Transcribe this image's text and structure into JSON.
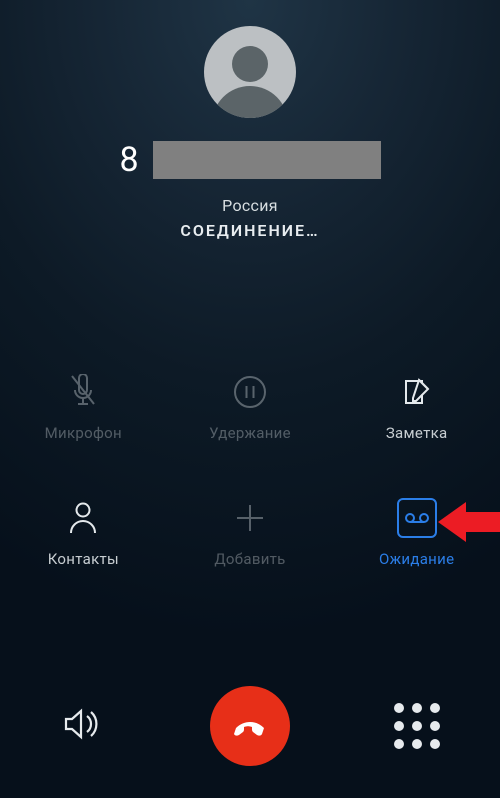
{
  "call": {
    "number_prefix": "8",
    "country": "Россия",
    "status": "СОЕДИНЕНИЕ…"
  },
  "buttons": {
    "mute": "Микрофон",
    "hold": "Удержание",
    "note": "Заметка",
    "contacts": "Контакты",
    "add": "Добавить",
    "waiting": "Ожидание"
  },
  "colors": {
    "accent": "#2b7ee8",
    "danger": "#e72f18",
    "redact": "#808080"
  }
}
